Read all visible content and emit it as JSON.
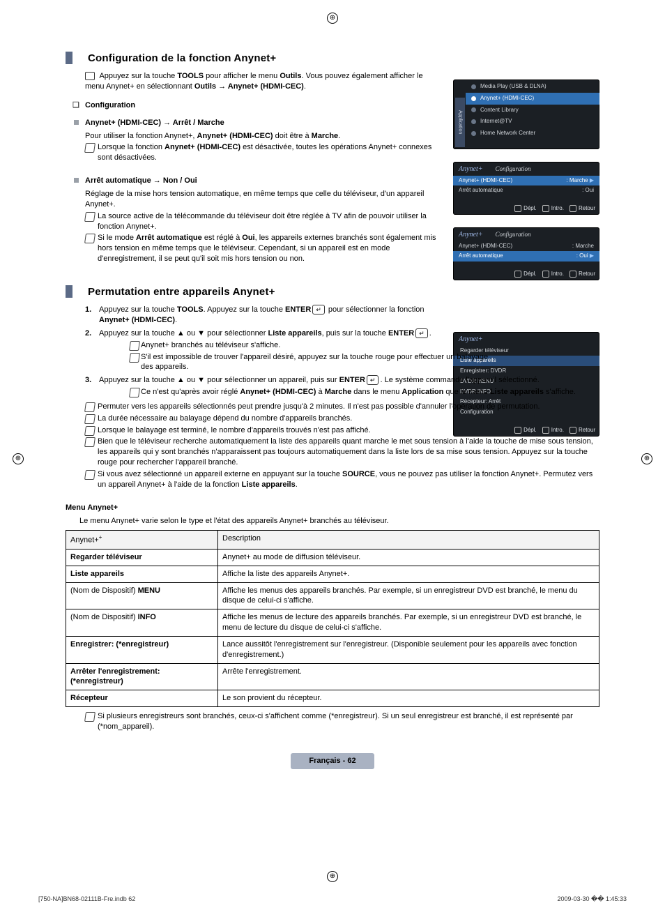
{
  "crop_mark": "⊕",
  "section1": {
    "title": "Configuration de la fonction Anynet+",
    "tool_line_pre": "Appuyez sur la touche ",
    "tool_line_b1": "TOOLS",
    "tool_line_mid": " pour afficher le menu ",
    "tool_line_b2": "Outils",
    "tool_line_post": ". Vous pouvez également afficher le menu Anynet+ en sélectionnant ",
    "tool_line_b3": "Outils → Anynet+ (HDMI-CEC)",
    "config_head": "Configuration",
    "h1": "Anynet+ (HDMI-CEC) → Arrêt / Marche",
    "h1_p": "Pour utiliser la fonction Anynet+, ",
    "h1_p_b": "Anynet+ (HDMI-CEC)",
    "h1_p2": " doit être à ",
    "h1_p2_b": "Marche",
    "h1_note": "Lorsque la fonction ",
    "h1_note_b": "Anynet+ (HDMI-CEC)",
    "h1_note2": " est désactivée, toutes les opérations Anynet+ connexes sont désactivées.",
    "h2": "Arrêt automatique → Non / Oui",
    "h2_p": "Réglage de la mise hors tension automatique, en même temps que celle du téléviseur, d'un appareil Anynet+.",
    "h2_n1": "La source active de la télécommande du téléviseur doit être réglée à TV afin de pouvoir utiliser la fonction Anynet+.",
    "h2_n2_a": "Si le mode ",
    "h2_n2_b": "Arrêt automatique",
    "h2_n2_c": " est réglé à ",
    "h2_n2_d": "Oui",
    "h2_n2_e": ", les appareils externes branchés sont également mis hors tension en même temps que le téléviseur. Cependant, si un appareil est en mode d'enregistrement, il se peut qu'il soit mis hors tension ou non."
  },
  "section2": {
    "title": "Permutation entre appareils Anynet+",
    "s1_a": "Appuyez sur la touche ",
    "s1_b": "TOOLS",
    "s1_c": ". Appuyez sur la touche ",
    "s1_d": "ENTER",
    "s1_e": " pour sélectionner la fonction ",
    "s1_f": "Anynet+ (HDMI-CEC)",
    "s2_a": "Appuyez sur la touche ▲ ou ▼ pour sélectionner ",
    "s2_b": "Liste appareils",
    "s2_c": ", puis sur la touche ",
    "s2_d": "ENTER",
    "s2_n1": "Anynet+ branchés au téléviseur s'affiche.",
    "s2_n2": "S'il est impossible de trouver l'appareil désiré, appuyez sur la touche rouge pour effectuer un balayage des appareils.",
    "s3_a": "Appuyez sur la touche ▲ ou ▼ pour sélectionner un appareil, puis sur ",
    "s3_b": "ENTER",
    "s3_c": ". Le système commande l'appareil sélectionné.",
    "s3_n1_a": "Ce n'est qu'après avoir réglé ",
    "s3_n1_b": "Anynet+ (HDMI-CEC)",
    "s3_n1_c": " à ",
    "s3_n1_d": "Marche",
    "s3_n1_e": " dans le menu ",
    "s3_n1_f": "Application",
    "s3_n1_g": " que le menu ",
    "s3_n1_h": "Liste appareils",
    "s3_n1_i": " s'affiche.",
    "nn1": "Permuter vers les appareils sélectionnés peut prendre jusqu'à 2 minutes. Il n'est pas possible d'annuler l'opération de permutation.",
    "nn2": "La durée nécessaire au balayage dépend du nombre d'appareils branchés.",
    "nn3": "Lorsque le balayage est terminé, le nombre d'appareils trouvés n'est pas affiché.",
    "nn4": "Bien que le téléviseur recherche automatiquement la liste des appareils quant marche le met sous tension à l'aide la touche de mise sous tension, les appareils qui y sont branchés n'apparaissent pas toujours automatiquement dans la liste lors de sa mise sous tension. Appuyez sur la touche rouge pour rechercher l'appareil branché.",
    "nn5_a": "Si vous avez sélectionné un appareil externe en appuyant sur la touche ",
    "nn5_b": "SOURCE",
    "nn5_c": ", vous ne pouvez pas utiliser la fonction Anynet+. Permutez vers un appareil Anynet+ à l'aide de la fonction ",
    "nn5_d": "Liste appareils"
  },
  "menu": {
    "head": "Menu Anynet+",
    "intro": "Le menu Anynet+ varie selon le type et l'état des appareils Anynet+ branchés au téléviseur.",
    "col1": "Anynet+",
    "col2": "Description",
    "rows": [
      {
        "a": "Regarder téléviseur",
        "d": "Anynet+ au mode de diffusion téléviseur."
      },
      {
        "a": "Liste appareils",
        "d": "Affiche la liste des appareils Anynet+."
      },
      {
        "a": "(Nom de Dispositif) MENU",
        "bolda": false,
        "d": "Affiche les menus des appareils branchés. Par exemple, si un enregistreur DVD est branché, le menu du disque de celui-ci s'affiche."
      },
      {
        "a": "(Nom de Dispositif) INFO",
        "bolda": false,
        "d": "Affiche les menus de lecture des appareils branchés. Par exemple, si un enregistreur DVD est branché, le menu de lecture du disque de celui-ci s'affiche."
      },
      {
        "a": "Enregistrer: (*enregistreur)",
        "d": "Lance aussitôt l'enregistrement sur l'enregistreur. (Disponible seulement pour les appareils avec fonction d'enregistrement.)"
      },
      {
        "a": "Arrêter l'enregistrement: (*enregistreur)",
        "d": "Arrête l'enregistrement."
      },
      {
        "a": "Récepteur",
        "d": "Le son provient du récepteur."
      }
    ],
    "tail": "Si plusieurs enregistreurs sont branchés, ceux-ci s'affichent comme (*enregistreur). Si un seul enregistreur est branché, il est représenté par (*nom_appareil)."
  },
  "osd": {
    "app_side": "Application",
    "menu1": [
      "Media Play (USB & DLNA)",
      "Anynet+ (HDMI-CEC)",
      "Content Library",
      "Internet@TV",
      "Home Network Center"
    ],
    "menu1_sel": 1,
    "cfg_title": "Configuration",
    "brand": "Anynet+",
    "cfg_rows": [
      {
        "l": "Anynet+ (HDMI-CEC)",
        "r": ": Marche"
      },
      {
        "l": "Arrêt automatique",
        "r": ": Oui"
      }
    ],
    "foot": [
      "Dépl.",
      "Intro.",
      "Retour"
    ],
    "list4": [
      "Regarder téléviseur",
      "Liste appareils",
      "Enregistrer: DVDR",
      "DVDR MENU",
      "DVDR INFO",
      "Récepteur: Arrêt",
      "Configuration"
    ],
    "list4_sel": 1
  },
  "footer": {
    "badge": "Français - 62",
    "left": "[750-NA]BN68-02111B-Fre.indb   62",
    "right": "2009-03-30   �� 1:45:33"
  }
}
